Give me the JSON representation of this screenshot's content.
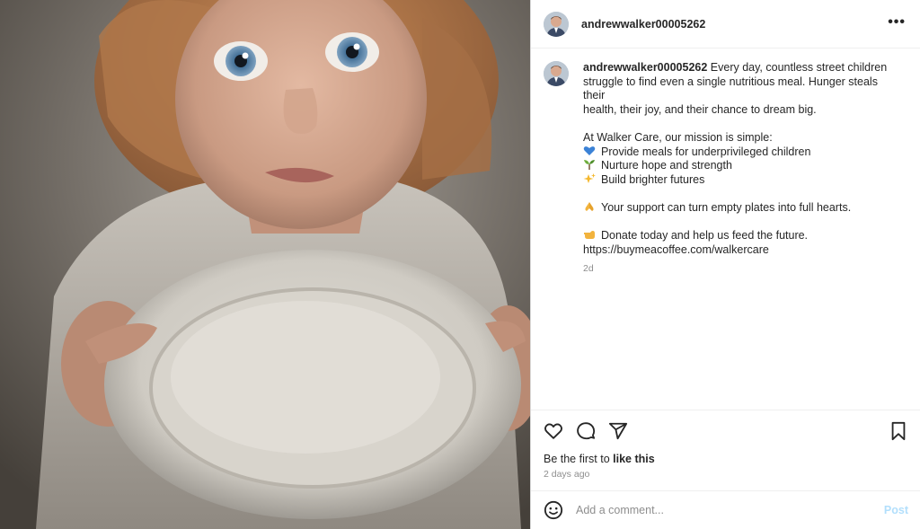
{
  "post": {
    "username": "andrewwalker00005262",
    "more_glyph": "•••",
    "image_alt": "child holding an empty plate",
    "caption": {
      "username": "andrewwalker00005262",
      "intro": "Every day, countless street children struggle to find even a single nutritious meal. Hunger steals their health, their joy, and their chance to dream big.",
      "intro_line1": "Every day, countless street children",
      "intro_line2": "struggle to find even a single nutritious meal. Hunger steals their",
      "intro_line3": "health, their joy, and their chance to dream big.",
      "mission": "At Walker Care, our mission is simple:",
      "bullets": [
        {
          "icon": "blue-heart-icon",
          "text": "Provide meals for underprivileged children"
        },
        {
          "icon": "seedling-icon",
          "text": "Nurture hope and strength"
        },
        {
          "icon": "sparkles-icon",
          "text": "Build brighter futures"
        }
      ],
      "support": "Your support can turn empty plates into full hearts.",
      "support_icon": "folded-hands-icon",
      "donate": "Donate today and help us feed the future.",
      "donate_icon": "pointing-hand-icon",
      "link": "https://buymeacoffee.com/walkercare",
      "age": "2d"
    },
    "likes_prefix": "Be the first to ",
    "likes_action": "like this",
    "date": "2 days ago",
    "comment_placeholder": "Add a comment...",
    "post_button": "Post"
  },
  "colors": {
    "text": "#262626",
    "muted": "#8e8e8e",
    "post_disabled": "#b2dffc",
    "border": "#dbdbdb"
  }
}
